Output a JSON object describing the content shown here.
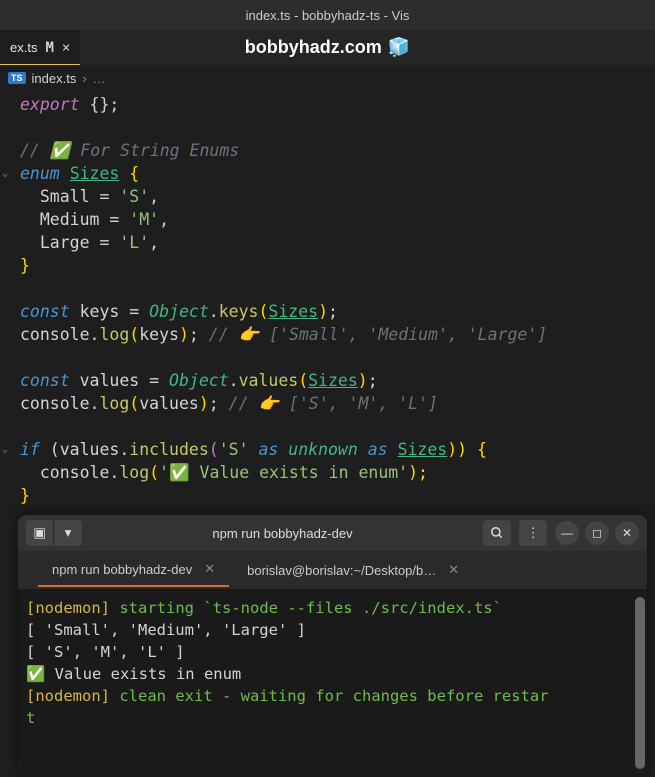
{
  "window": {
    "title": "index.ts - bobbyhadz-ts - Vis"
  },
  "tab": {
    "label": "ex.ts",
    "modified": "M",
    "close": "×"
  },
  "watermark": {
    "text": "bobbyhadz.com",
    "emoji": "🧊"
  },
  "breadcrumb": {
    "icon": "TS",
    "file": "index.ts",
    "sep": "›",
    "dots": "…"
  },
  "code": {
    "l1a": "export",
    "l1b": " {};",
    "l3": "// ✅ For String Enums",
    "l4a": "enum",
    "l4b": " ",
    "l4c": "Sizes",
    "l4d": " {",
    "l5a": "  Small ",
    "l5b": "=",
    "l5c": " ",
    "l5d": "'S'",
    "l5e": ",",
    "l6a": "  Medium ",
    "l6b": "=",
    "l6c": " ",
    "l6d": "'M'",
    "l6e": ",",
    "l7a": "  Large ",
    "l7b": "=",
    "l7c": " ",
    "l7d": "'L'",
    "l7e": ",",
    "l8": "}",
    "l10a": "const",
    "l10b": " keys ",
    "l10c": "=",
    "l10d": " ",
    "l10e": "Object",
    "l10f": ".",
    "l10g": "keys",
    "l10h": "(",
    "l10i": "Sizes",
    "l10j": ")",
    "l10k": ";",
    "l11a": "console.",
    "l11b": "log",
    "l11c": "(",
    "l11d": "keys",
    "l11e": ")",
    "l11f": "; ",
    "l11g": "// 👉️ ['Small', 'Medium', 'Large']",
    "l13a": "const",
    "l13b": " values ",
    "l13c": "=",
    "l13d": " ",
    "l13e": "Object",
    "l13f": ".",
    "l13g": "values",
    "l13h": "(",
    "l13i": "Sizes",
    "l13j": ")",
    "l13k": ";",
    "l14a": "console.",
    "l14b": "log",
    "l14c": "(",
    "l14d": "values",
    "l14e": ")",
    "l14f": "; ",
    "l14g": "// 👉️ ['S', 'M', 'L']",
    "l16a": "if",
    "l16b": " (values.",
    "l16c": "includes",
    "l16d": "(",
    "l16e": "'S'",
    "l16f": " ",
    "l16g": "as",
    "l16h": " ",
    "l16i": "unknown",
    "l16j": " ",
    "l16k": "as",
    "l16l": " ",
    "l16m": "Sizes",
    "l16n": ")) {",
    "l17a": "  console.",
    "l17b": "log",
    "l17c": "(",
    "l17d": "'✅ Value exists in enum'",
    "l17e": ");",
    "l18": "}"
  },
  "terminal": {
    "header_title": "npm run bobbyhadz-dev",
    "tabs": [
      {
        "label": "npm run bobbyhadz-dev"
      },
      {
        "label": "borislav@borislav:~/Desktop/b…"
      }
    ],
    "out": {
      "l1a": "[nodemon]",
      "l1b": " starting ",
      "l1c": "`ts-node --files ./src/index.ts`",
      "l2": "[ 'Small', 'Medium', 'Large' ]",
      "l3": "[ 'S', 'M', 'L' ]",
      "l4": "✅ Value exists in enum",
      "l5a": "[nodemon]",
      "l5b": " clean exit - waiting for changes before restar",
      "l6": "t"
    }
  }
}
